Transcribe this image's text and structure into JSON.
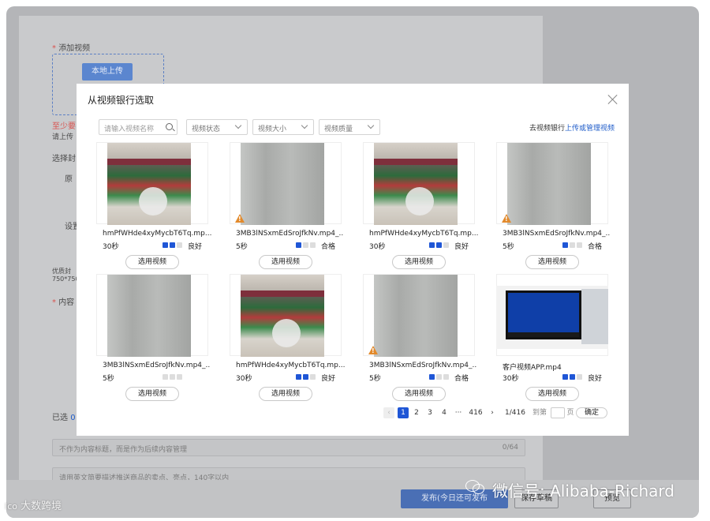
{
  "background": {
    "add_video_label": "添加视频",
    "upload_button": "本地上传",
    "error_text": "至少要",
    "hint_text": "请上传",
    "choose_cover": "选择封",
    "original": "原",
    "set": "设置",
    "cover_tip_1": "优质封",
    "cover_tip_2": "750*750",
    "content_label": "内容",
    "selected_label": "已选",
    "selected_count": "0",
    "title_placeholder": "不作为内容标题，而是作为后续内容管理",
    "title_count": "0/64",
    "desc_placeholder": "请用英文简要描述推送商品的卖点、亮点，140字以内",
    "publish_button": "发布(今日还可发布",
    "save_draft_button": "保存草稿",
    "preview_button": "预览"
  },
  "modal": {
    "title": "从视频银行选取",
    "search_placeholder": "请输入视频名称",
    "filters": [
      "视频状态",
      "视频大小",
      "视频质量"
    ],
    "manage_prefix": "去视频银行",
    "manage_link": "上传或管理视频",
    "select_label": "选用视频",
    "videos": [
      {
        "name": "hmPfWHde4xyMycbT6Tq.mp...",
        "duration": "30秒",
        "quality": "良好",
        "level": 2,
        "thumb": "store",
        "warning": false
      },
      {
        "name": "3MB3lNSxmEdSroJfkNv.mp4_..",
        "duration": "5秒",
        "quality": "合格",
        "level": 1,
        "thumb": "wall",
        "warning": true
      },
      {
        "name": "hmPfWHde4xyMycbT6Tq.mp...",
        "duration": "30秒",
        "quality": "良好",
        "level": 2,
        "thumb": "store",
        "warning": false
      },
      {
        "name": "3MB3lNSxmEdSroJfkNv.mp4_..",
        "duration": "5秒",
        "quality": "合格",
        "level": 1,
        "thumb": "wall",
        "warning": true
      },
      {
        "name": "3MB3lNSxmEdSroJfkNv.mp4_..",
        "duration": "5秒",
        "quality": "",
        "level": 0,
        "thumb": "wall",
        "warning": false
      },
      {
        "name": "hmPfWHde4xyMycbT6Tq.mp...",
        "duration": "30秒",
        "quality": "良好",
        "level": 2,
        "thumb": "store",
        "warning": false
      },
      {
        "name": "3MB3lNSxmEdSroJfkNv.mp4_..",
        "duration": "5秒",
        "quality": "合格",
        "level": 1,
        "thumb": "wall",
        "warning": true
      },
      {
        "name": "客户视频APP.mp4",
        "duration": "30秒",
        "quality": "良好",
        "level": 2,
        "thumb": "screen",
        "warning": false
      }
    ],
    "pagination": {
      "prev": "‹",
      "pages": [
        "1",
        "2",
        "3",
        "4"
      ],
      "ellipsis": "···",
      "last": "416",
      "next": "›",
      "total": "1/416",
      "jump_to": "到第",
      "page_unit": "页",
      "confirm": "确定"
    }
  },
  "watermark": {
    "wechat": "微信号: Alibaba-Richard",
    "logo_mark": "Ico",
    "logo_text": "大数跨境"
  }
}
